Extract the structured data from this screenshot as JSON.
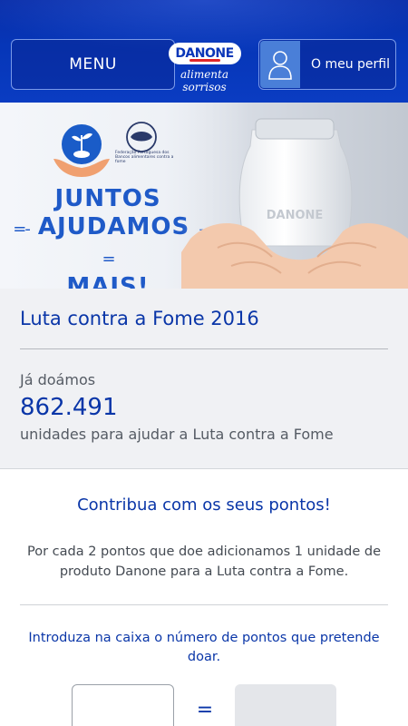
{
  "header": {
    "menu_label": "MENU",
    "brand_name": "DANONE",
    "brand_tagline": "alimenta sorrisos",
    "profile_label": "O meu perfil",
    "profile_icon": "user-silhouette-icon",
    "colors": {
      "header_blue": "#0636b8",
      "brand_red": "#e0262a"
    }
  },
  "banner": {
    "slogan_line1": "JUNTOS",
    "slogan_line2": "AJUDAMOS",
    "slogan_line3": "MAIS!",
    "federation_text": "Federação Portuguesa dos Bancos alimentares contra a fome",
    "bottle_text": "DANONE"
  },
  "summary": {
    "title": "Luta contra a Fome 2016",
    "donated_label": "Já doámos",
    "donated_units": "862.491",
    "donated_desc": "unidades para ajudar a Luta contra a Fome"
  },
  "contribute": {
    "title": "Contribua com os seus pontos!",
    "description": "Por cada 2 pontos que doe adicionamos 1 unidade de produto Danone para a Luta contra a Fome.",
    "instruction": "Introduza na caixa o número de pontos que pretende doar.",
    "points_value": "",
    "equals_sign": "=",
    "result_value": ""
  },
  "colors": {
    "accent_blue": "#0a36a8",
    "text_gray": "#555b64",
    "panel_gray": "#f0f1f4"
  }
}
